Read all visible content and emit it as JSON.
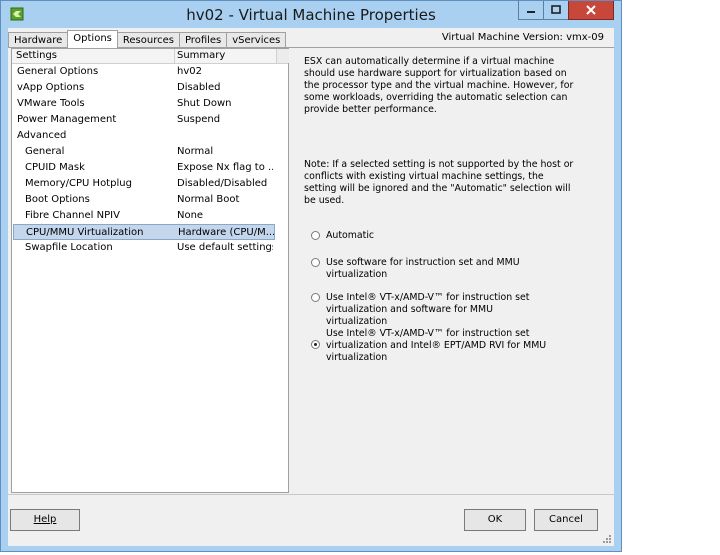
{
  "window": {
    "title": "hv02 - Virtual Machine Properties"
  },
  "tabs": [
    {
      "label": "Hardware",
      "active": false
    },
    {
      "label": "Options",
      "active": true
    },
    {
      "label": "Resources",
      "active": false
    },
    {
      "label": "Profiles",
      "active": false
    },
    {
      "label": "vServices",
      "active": false
    }
  ],
  "vm_version": "Virtual Machine Version: vmx-09",
  "list": {
    "headers": {
      "settings": "Settings",
      "summary": "Summary"
    },
    "rows": [
      {
        "name": "General Options",
        "value": "hv02",
        "indent": false,
        "selected": false
      },
      {
        "name": "vApp Options",
        "value": "Disabled",
        "indent": false,
        "selected": false
      },
      {
        "name": "VMware Tools",
        "value": "Shut Down",
        "indent": false,
        "selected": false
      },
      {
        "name": "Power Management",
        "value": "Suspend",
        "indent": false,
        "selected": false
      },
      {
        "name": "Advanced",
        "value": "",
        "indent": false,
        "selected": false
      },
      {
        "name": "General",
        "value": "Normal",
        "indent": true,
        "selected": false
      },
      {
        "name": "CPUID Mask",
        "value": "Expose Nx flag to ...",
        "indent": true,
        "selected": false
      },
      {
        "name": "Memory/CPU Hotplug",
        "value": "Disabled/Disabled",
        "indent": true,
        "selected": false
      },
      {
        "name": "Boot Options",
        "value": "Normal Boot",
        "indent": true,
        "selected": false
      },
      {
        "name": "Fibre Channel NPIV",
        "value": "None",
        "indent": true,
        "selected": false
      },
      {
        "name": "CPU/MMU Virtualization",
        "value": "Hardware (CPU/M...",
        "indent": true,
        "selected": true
      },
      {
        "name": "Swapfile Location",
        "value": "Use default settings",
        "indent": true,
        "selected": false
      }
    ]
  },
  "detail": {
    "description": "ESX can automatically determine if a virtual machine should use hardware support for virtualization based on the processor type and the virtual machine. However, for some workloads, overriding the automatic selection can provide better performance.",
    "note": "Note: If a selected setting is not supported by the host or conflicts with existing virtual machine settings, the setting will be ignored and the \"Automatic\" selection will be used.",
    "options": [
      {
        "label": "Automatic",
        "checked": false
      },
      {
        "label": "Use software for instruction set and MMU virtualization",
        "checked": false
      },
      {
        "label": "Use Intel® VT-x/AMD-V™ for instruction set virtualization and software for MMU virtualization",
        "checked": false
      },
      {
        "label": "Use Intel® VT-x/AMD-V™ for instruction set virtualization and Intel® EPT/AMD RVI for MMU virtualization",
        "checked": true
      }
    ]
  },
  "buttons": {
    "help": "Help",
    "ok": "OK",
    "cancel": "Cancel"
  },
  "icons": {
    "app": "vsphere-app-icon",
    "minimize": "minimize-icon",
    "maximize": "maximize-icon",
    "close": "close-icon"
  }
}
